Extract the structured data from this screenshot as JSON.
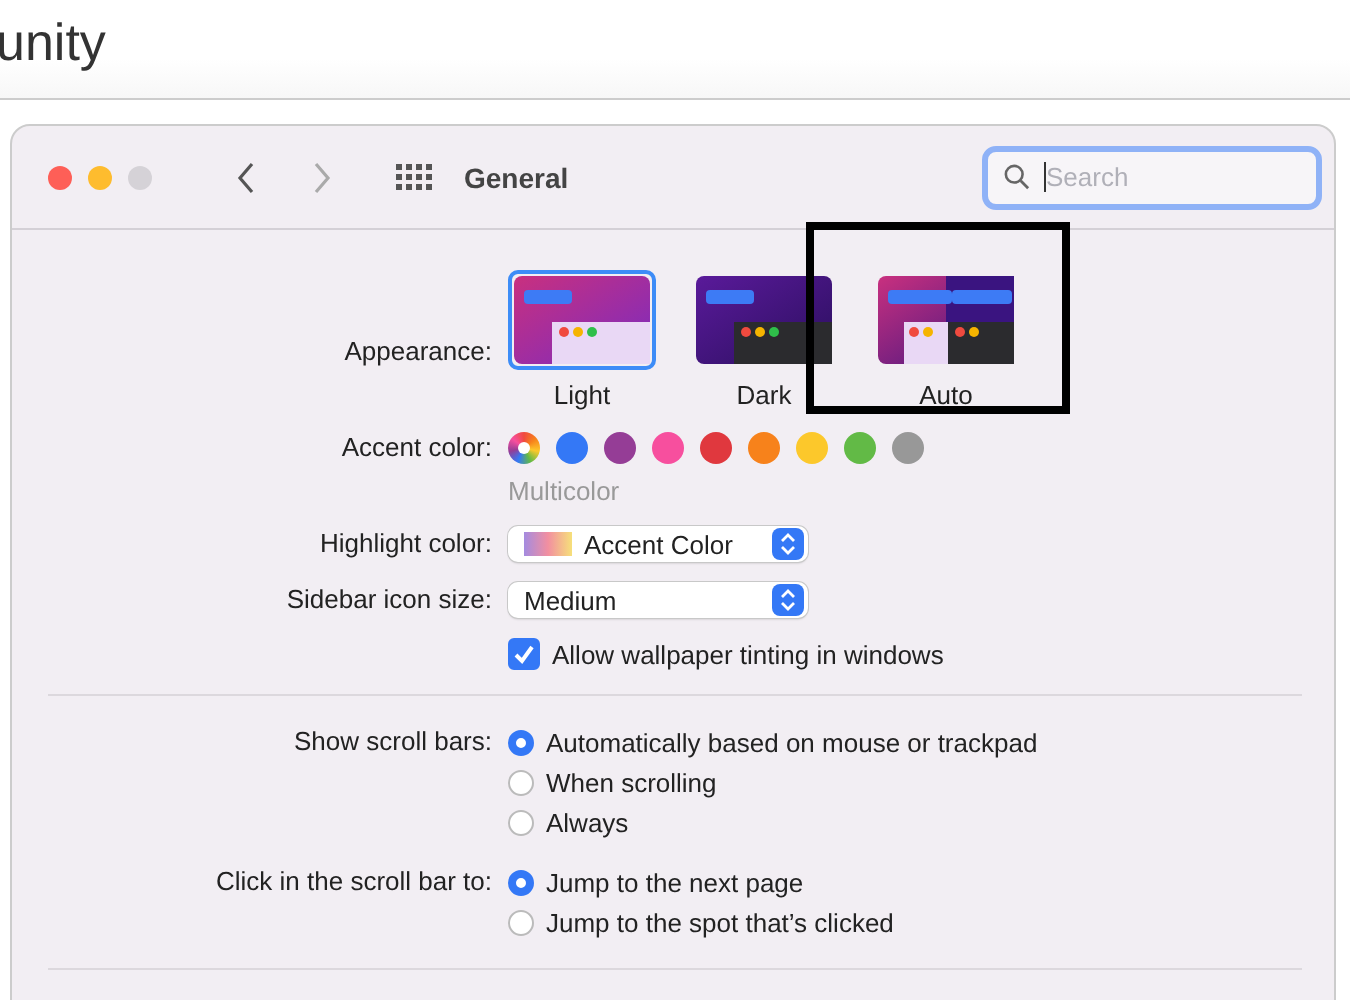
{
  "page_heading": "unity",
  "window": {
    "title": "General",
    "search": {
      "placeholder": "Search",
      "focused": true
    }
  },
  "appearance": {
    "label": "Appearance:",
    "options": [
      {
        "label": "Light",
        "kind": "light",
        "selected": true
      },
      {
        "label": "Dark",
        "kind": "dark",
        "selected": false
      },
      {
        "label": "Auto",
        "kind": "auto",
        "selected": false
      }
    ]
  },
  "annotation": {
    "shown": true
  },
  "accent_color": {
    "label": "Accent color:",
    "caption": "Multicolor",
    "swatches": [
      {
        "kind": "multicolor",
        "selected": true
      },
      {
        "kind": "solid",
        "color": "#3478f6",
        "selected": false
      },
      {
        "kind": "solid",
        "color": "#953d96",
        "selected": false
      },
      {
        "kind": "solid",
        "color": "#f74f9e",
        "selected": false
      },
      {
        "kind": "solid",
        "color": "#e0383e",
        "selected": false
      },
      {
        "kind": "solid",
        "color": "#f7821b",
        "selected": false
      },
      {
        "kind": "solid",
        "color": "#fcc82b",
        "selected": false
      },
      {
        "kind": "solid",
        "color": "#62ba46",
        "selected": false
      },
      {
        "kind": "solid",
        "color": "#989898",
        "selected": false
      }
    ]
  },
  "highlight_color": {
    "label": "Highlight color:",
    "value": "Accent Color"
  },
  "sidebar_icon_size": {
    "label": "Sidebar icon size:",
    "value": "Medium"
  },
  "wallpaper_tinting": {
    "label": "Allow wallpaper tinting in windows",
    "checked": true
  },
  "show_scroll_bars": {
    "label": "Show scroll bars:",
    "options": [
      {
        "label": "Automatically based on mouse or trackpad",
        "selected": true
      },
      {
        "label": "When scrolling",
        "selected": false
      },
      {
        "label": "Always",
        "selected": false
      }
    ]
  },
  "click_scroll_bar": {
    "label": "Click in the scroll bar to:",
    "options": [
      {
        "label": "Jump to the next page",
        "selected": true
      },
      {
        "label": "Jump to the spot that’s clicked",
        "selected": false
      }
    ]
  }
}
